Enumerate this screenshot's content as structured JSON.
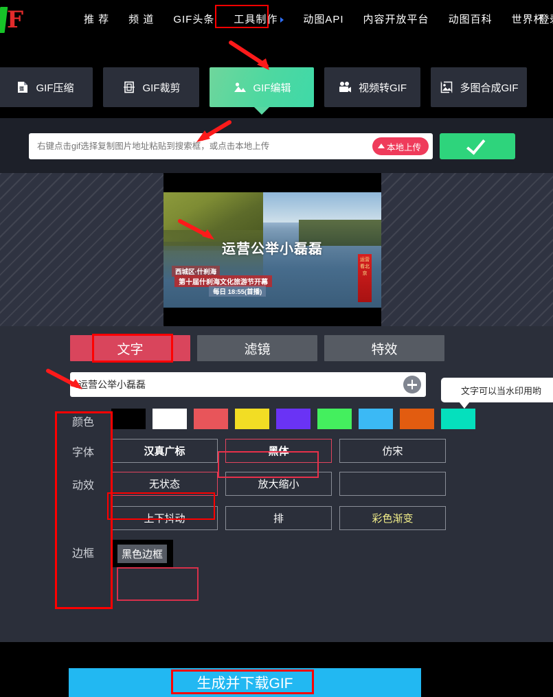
{
  "nav": {
    "logo_alt": "gif-logo",
    "links": [
      {
        "label": "推 荐",
        "icon": ""
      },
      {
        "label": "频 道",
        "icon": ""
      },
      {
        "label": "GIF头条",
        "icon": ""
      },
      {
        "label": "工具制作",
        "icon": "caret-down"
      },
      {
        "label": "动图API",
        "icon": ""
      },
      {
        "label": "内容开放平台",
        "icon": ""
      },
      {
        "label": "动图百科",
        "icon": ""
      },
      {
        "label": "世界杯",
        "icon": ""
      }
    ],
    "login_label": "登录"
  },
  "tools": [
    {
      "label": "GIF压缩",
      "icon": "zip-file-icon",
      "active": false
    },
    {
      "label": "GIF裁剪",
      "icon": "crop-icon",
      "active": false
    },
    {
      "label": "GIF编辑",
      "icon": "image-edit-icon",
      "active": true
    },
    {
      "label": "视频转GIF",
      "icon": "video-camera-icon",
      "active": false
    },
    {
      "label": "多图合成GIF",
      "icon": "multi-image-icon",
      "active": false
    }
  ],
  "search": {
    "placeholder": "右键点击gif选择复制图片地址粘贴到搜索框，或点击本地上传",
    "value": "",
    "upload_label": "本地上传",
    "confirm_icon": "check-icon"
  },
  "preview": {
    "watermark_text": "运营公举小磊磊",
    "subtitle_1": "西城区·什刹海",
    "subtitle_2": "第十届什刹海文化旅游节开幕",
    "subtitle_3": "每日 18:55(首播)",
    "banner_text": "运营看北京"
  },
  "panel": {
    "tabs": [
      {
        "label": "文字",
        "active": true
      },
      {
        "label": "滤镜",
        "active": false
      },
      {
        "label": "特效",
        "active": false
      }
    ],
    "text_input": {
      "value": "运营公举小磊磊",
      "placeholder": "",
      "add_icon": "plus-icon"
    },
    "tooltip": {
      "text": "文字可以当水印用哟",
      "close_icon": "close-icon"
    },
    "color": {
      "label": "颜色",
      "swatches": [
        {
          "name": "black",
          "hex": "#000000"
        },
        {
          "name": "white",
          "hex": "#ffffff"
        },
        {
          "name": "coral-red",
          "hex": "#e8555a"
        },
        {
          "name": "yellow",
          "hex": "#f2dd24"
        },
        {
          "name": "purple",
          "hex": "#6a33f5"
        },
        {
          "name": "green",
          "hex": "#44ef5e"
        },
        {
          "name": "sky-blue",
          "hex": "#3bb9f5"
        },
        {
          "name": "orange",
          "hex": "#e25c10"
        },
        {
          "name": "teal",
          "hex": "#05e0bd"
        }
      ]
    },
    "font": {
      "label": "字体",
      "options": [
        {
          "label": "汉真广标",
          "selected": false
        },
        {
          "label": "黑体",
          "selected": true
        },
        {
          "label": "仿宋",
          "selected": false
        }
      ]
    },
    "animation": {
      "label": "动效",
      "options": [
        {
          "label": "无状态",
          "selected": true
        },
        {
          "label": "放大缩小",
          "selected": false
        },
        {
          "label": "",
          "selected": false
        },
        {
          "label": "上下抖动",
          "selected": false
        },
        {
          "label": "排",
          "selected": false
        },
        {
          "label": "彩色渐变",
          "selected": false
        }
      ]
    },
    "border": {
      "label": "边框",
      "options": [
        {
          "label": "黑色边框",
          "selected": true
        }
      ]
    }
  },
  "footer": {
    "generate_label": "生成并下载GIF"
  },
  "colors": {
    "accent_green": "#3fd9a8",
    "accent_pink": "#d9455c",
    "accent_blue": "#22b8f2",
    "annotation_red": "#ff0000",
    "upload_red": "#ef3b5b"
  }
}
